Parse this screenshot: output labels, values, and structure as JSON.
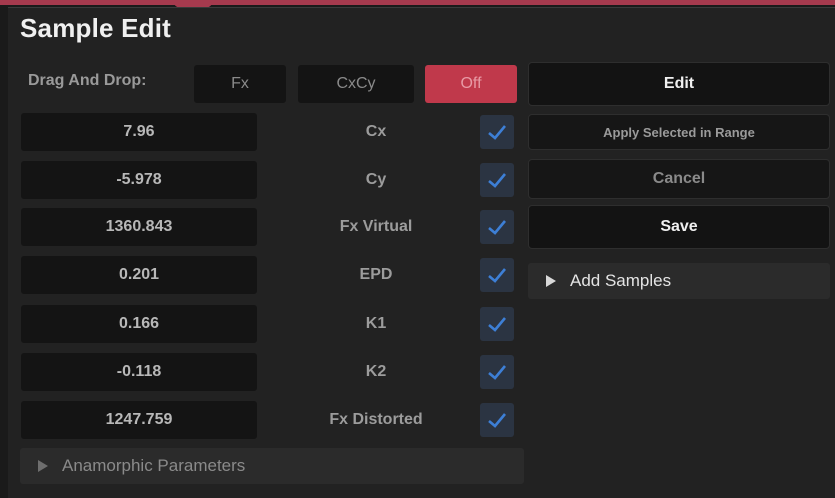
{
  "panel": {
    "title": "Sample Edit"
  },
  "drag_and_drop": {
    "label": "Drag And Drop:",
    "modes": [
      "Fx",
      "CxCy",
      "Off"
    ],
    "active_mode": "Off"
  },
  "params": [
    {
      "value": "7.96",
      "label": "Cx",
      "checked": true
    },
    {
      "value": "-5.978",
      "label": "Cy",
      "checked": true
    },
    {
      "value": "1360.843",
      "label": "Fx Virtual",
      "checked": true
    },
    {
      "value": "0.201",
      "label": "EPD",
      "checked": true
    },
    {
      "value": "0.166",
      "label": "K1",
      "checked": true
    },
    {
      "value": "-0.118",
      "label": "K2",
      "checked": true
    },
    {
      "value": "1247.759",
      "label": "Fx Distorted",
      "checked": true
    }
  ],
  "actions": {
    "edit": "Edit",
    "apply_selected": "Apply Selected in Range",
    "cancel": "Cancel",
    "save": "Save"
  },
  "sections": {
    "add_samples": "Add Samples",
    "anamorphic": "Anamorphic Parameters"
  },
  "colors": {
    "accent": "#a63a4e",
    "off_button": "#c0394b",
    "checkmark": "#3d7fd6"
  }
}
